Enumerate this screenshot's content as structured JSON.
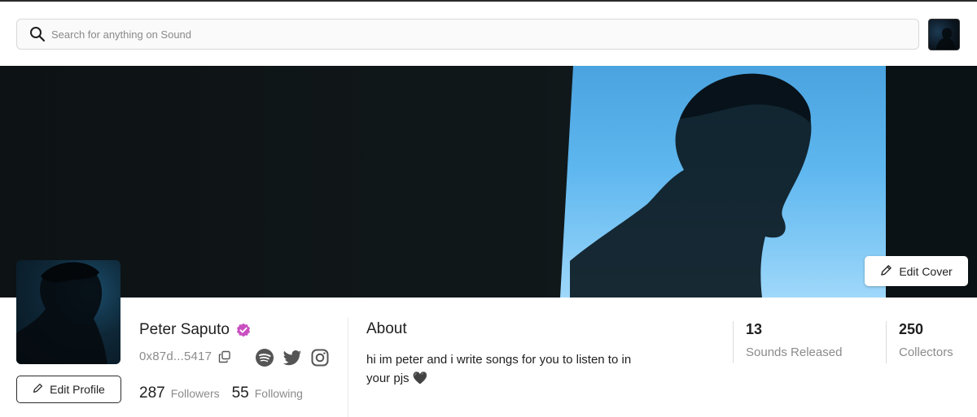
{
  "search": {
    "placeholder": "Search for anything on Sound"
  },
  "cover": {
    "edit_cover_label": "Edit Cover"
  },
  "profile": {
    "name": "Peter Saputo",
    "address": "0x87d...5417",
    "edit_profile_label": "Edit Profile",
    "followers_count": "287",
    "followers_label": "Followers",
    "following_count": "55",
    "following_label": "Following",
    "social": [
      "spotify-icon",
      "twitter-icon",
      "instagram-icon"
    ]
  },
  "about": {
    "title": "About",
    "text": "hi im peter and i write songs for you to listen to in your pjs 🖤"
  },
  "stats": [
    {
      "value": "13",
      "label": "Sounds Released"
    },
    {
      "value": "250",
      "label": "Collectors"
    }
  ],
  "colors": {
    "verified": "#c94fc0",
    "accent_dark": "#1f1f1f",
    "muted": "#8b8b8b"
  }
}
